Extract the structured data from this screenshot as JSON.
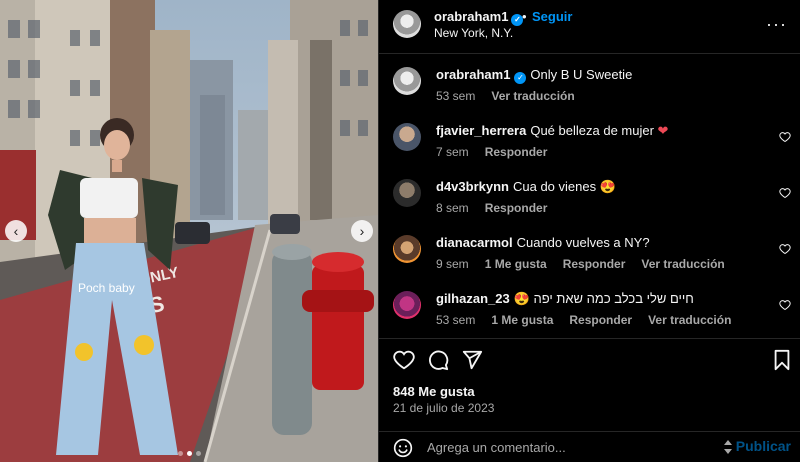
{
  "post": {
    "username": "orabraham1",
    "follow_label": "Seguir",
    "bullet": "•",
    "location": "New York, N.Y.",
    "more_icon": "more-horizontal-icon"
  },
  "caption": {
    "username": "orabraham1",
    "text": "Only B U Sweetie",
    "time": "53 sem",
    "translate": "Ver traducción"
  },
  "comments": [
    {
      "username": "fjavier_herrera",
      "text": "Qué belleza de mujer",
      "emoji": "❤",
      "time": "7 sem",
      "likes": "",
      "reply": "Responder",
      "translate": ""
    },
    {
      "username": "d4v3brkynn",
      "text": "Cua do vienes",
      "emoji": "😍",
      "time": "8 sem",
      "likes": "",
      "reply": "Responder",
      "translate": ""
    },
    {
      "username": "dianacarmol",
      "text": "Cuando vuelves a NY?",
      "emoji": "",
      "time": "9 sem",
      "likes": "1 Me gusta",
      "reply": "Responder",
      "translate": "Ver traducción"
    },
    {
      "username": "gilhazan_23",
      "text": "חיים שלי בכלב כמה שאת יפה",
      "emoji": "😍",
      "time": "53 sem",
      "likes": "1 Me gusta",
      "reply": "Responder",
      "translate": "Ver traducción"
    }
  ],
  "actions": {
    "likes": "848 Me gusta",
    "date": "21 de julio de 2023",
    "comment_placeholder": "Agrega un comentario...",
    "publish": "Publicar"
  },
  "photo": {
    "street_text_1": "ONLY",
    "street_text_2": "BUS",
    "jeans_text": "Poch baby"
  },
  "colors": {
    "accent": "#0095f6",
    "background": "#000000",
    "secondary_text": "#a8a8a8",
    "like_red": "#ed4956"
  }
}
